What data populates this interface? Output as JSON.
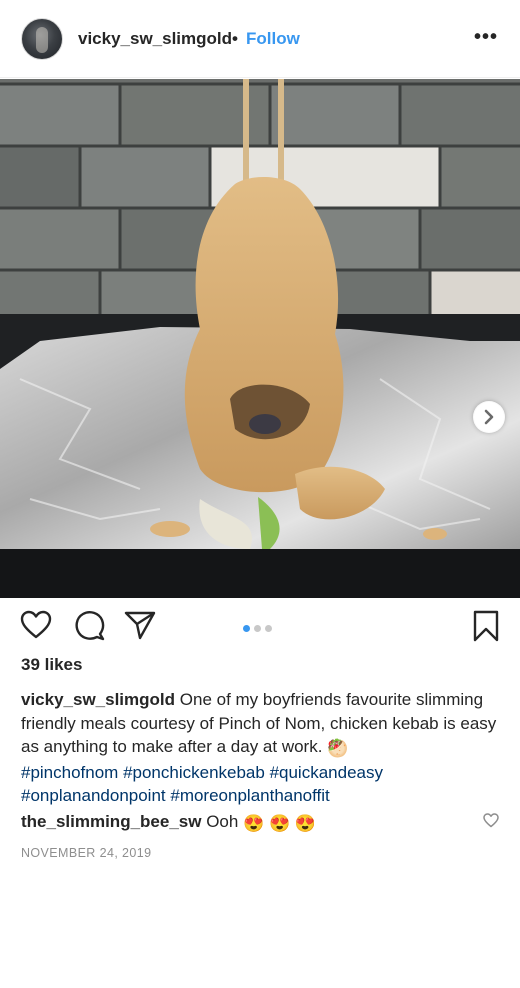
{
  "post": {
    "username": "vicky_sw_slimgold",
    "separator": "•",
    "follow_label": "Follow",
    "more_label": "•••",
    "avatar_icon": "profile-photo",
    "photo_icon": "food-photo-chicken-kebab",
    "carousel": {
      "total": 3,
      "current": 1
    },
    "likes": "39 likes",
    "caption": {
      "username": "vicky_sw_slimgold",
      "text": "One of my boyfriends favourite slimming friendly meals courtesy of Pinch of Nom, chicken kebab is easy as anything to make after a day at work.",
      "emoji": "🥙",
      "hashtags": "#pinchofnom #ponchickenkebab #quickandeasy #onplanandonpoint #moreonplanthanoffit"
    },
    "comment": {
      "username": "the_slimming_bee_sw",
      "text": "Ooh",
      "emojis": "😍 😍 😍"
    },
    "date": "NOVEMBER 24, 2019"
  },
  "colors": {
    "link": "#3897f0",
    "hashtag": "#003569",
    "muted": "#8e8e8e",
    "text": "#262626"
  },
  "icons": [
    "heart-icon",
    "comment-icon",
    "share-icon",
    "bookmark-icon",
    "chevron-right-icon",
    "like-comment-heart-icon"
  ]
}
